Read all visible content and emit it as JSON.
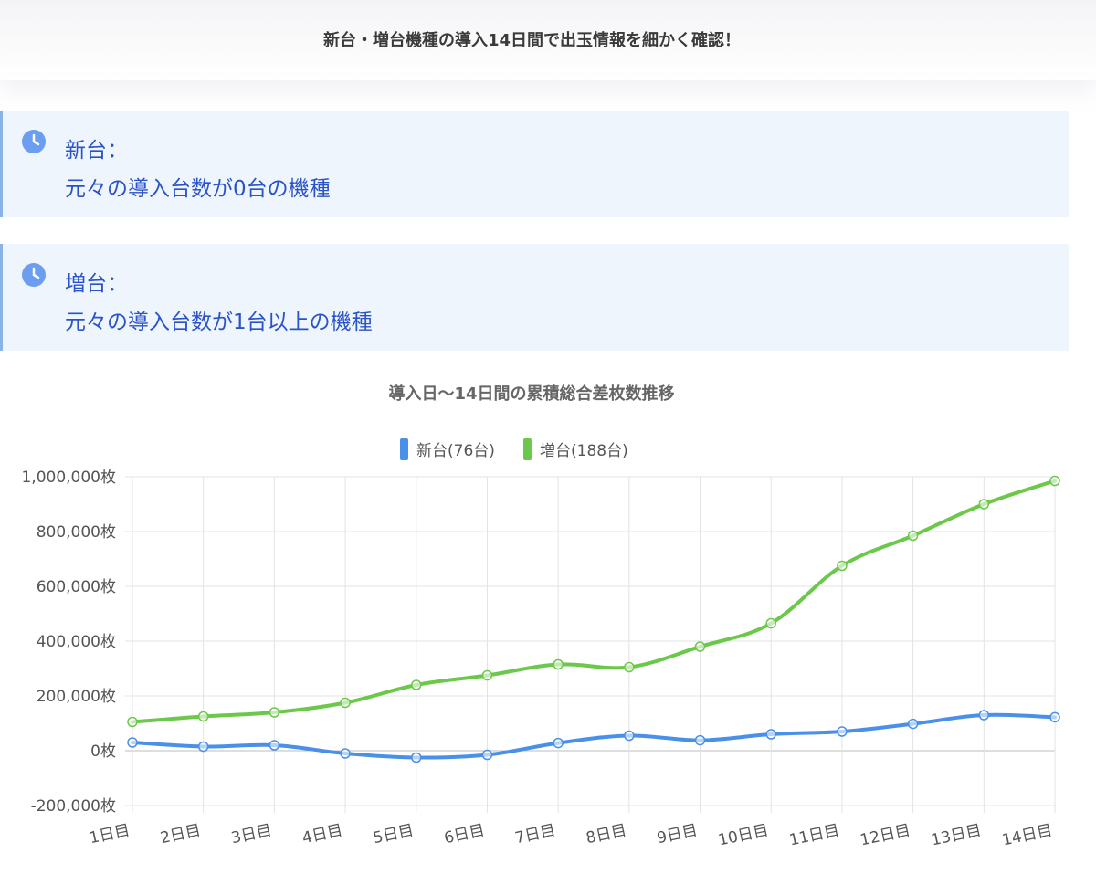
{
  "header": {
    "text": "新台・増台機種の導入14日間で出玉情報を細かく確認！"
  },
  "info_boxes": [
    {
      "icon": "clock-icon",
      "title": "新台：",
      "description": "元々の導入台数が0台の機種"
    },
    {
      "icon": "clock-icon",
      "title": "増台：",
      "description": "元々の導入台数が1台以上の機種"
    }
  ],
  "colors": {
    "new": "#4a90e8",
    "added": "#6cc84a",
    "accent": "#2b53c8",
    "box_bg": "#eef5fd"
  },
  "chart_data": {
    "type": "line",
    "title": "導入日〜14日間の累積総合差枚数推移",
    "categories": [
      "1日目",
      "2日目",
      "3日目",
      "4日目",
      "5日目",
      "6日目",
      "7日目",
      "8日目",
      "9日目",
      "10日目",
      "11日目",
      "12日目",
      "13日目",
      "14日目"
    ],
    "series": [
      {
        "name": "新台(76台)",
        "color": "#4a90e8",
        "values": [
          30000,
          15000,
          20000,
          -10000,
          -25000,
          -15000,
          28000,
          55000,
          38000,
          60000,
          70000,
          98000,
          130000,
          122000
        ]
      },
      {
        "name": "増台(188台)",
        "color": "#6cc84a",
        "values": [
          105000,
          125000,
          140000,
          175000,
          240000,
          275000,
          315000,
          305000,
          380000,
          465000,
          675000,
          785000,
          900000,
          985000
        ]
      }
    ],
    "ylim": [
      -200000,
      1000000
    ],
    "yticks": [
      -200000,
      0,
      200000,
      400000,
      600000,
      800000,
      1000000
    ],
    "ytick_labels": [
      "-200,000枚",
      "0枚",
      "200,000枚",
      "400,000枚",
      "600,000枚",
      "800,000枚",
      "1,000,000枚"
    ],
    "legend_position": "top-center",
    "grid": true
  }
}
